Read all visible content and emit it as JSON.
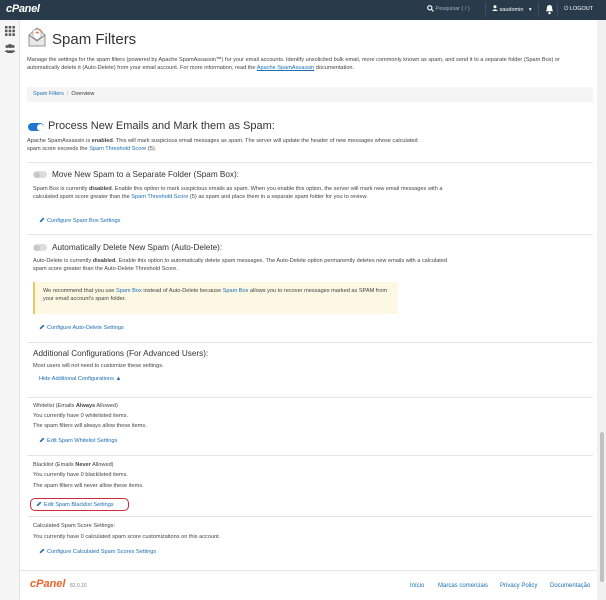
{
  "topbar": {
    "logo": "cPanel",
    "search_placeholder": "Pesquisar ( / )",
    "username": "saudomin",
    "logout": "LOGOUT"
  },
  "header": {
    "title": "Spam Filters",
    "intro_1": "Manage the settings for the spam filters (powered by Apache SpamAssassin™) for your email accounts. Identify unsolicited bulk email, more commonly known as spam, and send it to a separate folder (Spam Box) or automatically delete it (Auto-Delete) from your email account. For more information, read the ",
    "intro_link": "Apache SpamAssassin",
    "intro_2": " documentation."
  },
  "breadcrumb": {
    "root": "Spam Filters",
    "divider": "/",
    "current": "Overview"
  },
  "process": {
    "heading": "Process New Emails and Mark them as Spam:",
    "desc_1": "Apache SpamAssassin is ",
    "desc_bold": "enabled",
    "desc_2": ". This will mark suspicious email messages as spam. The server will update the header of new messages whose calculated spam score exceeds the ",
    "desc_link": "Spam Threshold Score",
    "desc_3": " (5)."
  },
  "spambox": {
    "heading": "Move New Spam to a Separate Folder (Spam Box):",
    "desc_1": "Spam Box is currently ",
    "desc_bold": "disabled",
    "desc_2": ". Enable this option to mark suspicious emails as spam. When you enable this option, the server will mark new email messages with a calculated spam score greater than the ",
    "desc_link": "Spam Threshold Score",
    "desc_3": " (5) as spam and place them in a separate spam folder for you to review.",
    "link": "Configure Spam Box Settings"
  },
  "autodelete": {
    "heading": "Automatically Delete New Spam (Auto-Delete):",
    "desc_1": "Auto-Delete is currently ",
    "desc_bold": "disabled",
    "desc_2": ". Enable this option to automatically delete spam messages. The Auto-Delete option permanently deletes new emails with a calculated spam score greater than the Auto-Delete Threshold Score.",
    "warn_1": "We recommend that you use ",
    "warn_link1": "Spam Box",
    "warn_2": " instead of Auto-Delete because ",
    "warn_link2": "Spam Box",
    "warn_3": " allows you to recover messages marked as SPAM from your email account's spam folder.",
    "link": "Configure Auto-Delete Settings"
  },
  "additional": {
    "heading": "Additional Configurations (For Advanced Users):",
    "desc": "Most users will not need to customize these settings.",
    "toggle_link": "Hide Additional Configurations"
  },
  "whitelist": {
    "title_1": "Whitelist (Emails ",
    "title_bold": "Always",
    "title_2": " Allowed)",
    "count": "You currently have 0 whitelisted items.",
    "note": "The spam filters will always allow these items.",
    "link": "Edit Spam Whitelist Settings"
  },
  "blacklist": {
    "title_1": "Blacklist (Emails ",
    "title_bold": "Never",
    "title_2": " Allowed)",
    "count": "You currently have 0 blacklisted items.",
    "note": "The spam filters will never allow these items.",
    "link": "Edit Spam Blacklist Settings"
  },
  "calculated": {
    "title": "Calculated Spam Score Settings:",
    "count": "You currently have 0 calculated spam score customizations on this account.",
    "link": "Configure Calculated Spam Scores Settings"
  },
  "footer": {
    "logo": "cPanel",
    "version": "82.0.16",
    "links": [
      "Início",
      "Marcas comerciais",
      "Privacy Policy",
      "Documentação"
    ]
  },
  "colors": {
    "topbar": "#293a4a",
    "link": "#1a6fb5",
    "toggle_on": "#1f77d0",
    "highlight": "#d0293a",
    "footer_logo": "#e8652a"
  }
}
